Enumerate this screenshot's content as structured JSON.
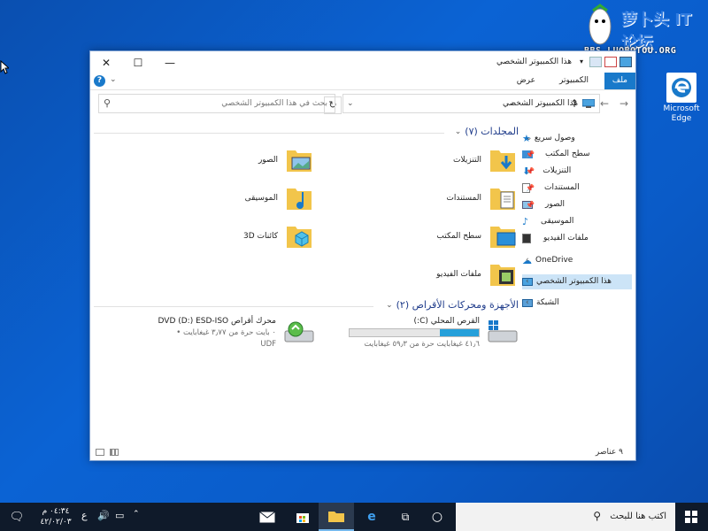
{
  "watermark": {
    "logo": "萝卜头 IT论坛",
    "site": "BBS.LUOBOTOU.ORG"
  },
  "desktop": {
    "edge_label_line1": "Microsoft",
    "edge_label_line2": "Edge"
  },
  "window": {
    "title": "هذا الكمبيوتر الشخصي",
    "tabs": {
      "file": "ملف",
      "computer": "الكمبيوتر",
      "view": "عرض"
    },
    "address": "هذا الكمبيوتر الشخصي",
    "search_placeholder": "بحث في هذا الكمبيوتر الشخصي",
    "folders_header": "المجلدات (٧)",
    "folders": [
      {
        "label": "التنزيلات",
        "icon": "downloads-folder-icon"
      },
      {
        "label": "الصور",
        "icon": "pictures-folder-icon"
      },
      {
        "label": "المستندات",
        "icon": "documents-folder-icon"
      },
      {
        "label": "الموسيقى",
        "icon": "music-folder-icon"
      },
      {
        "label": "سطح المكتب",
        "icon": "desktop-folder-icon"
      },
      {
        "label": "كائنات 3D",
        "icon": "3d-objects-folder-icon"
      },
      {
        "label": "ملفات الفيديو",
        "icon": "videos-folder-icon"
      }
    ],
    "drives_header": "الأجهزة ومحركات الأقراص (٢)",
    "drive_c": {
      "name": "القرص المحلي (C:)",
      "free": "٤١٫٦ غيغابايت حرة من ٥٩٫٣ غيغابايت",
      "used_fraction": 0.3
    },
    "drive_d": {
      "name": "محرك أقراص DVD (D:) ESD-ISO",
      "free": "٠ بايت حرة من ٣٫٧٧ غيغابايت",
      "fs": "UDF"
    },
    "nav": {
      "quick_access": "وصول سريع",
      "desktop": "سطح المكتب",
      "downloads": "التنزيلات",
      "documents": "المستندات",
      "pictures": "الصور",
      "music": "الموسيقى",
      "videos": "ملفات الفيديو",
      "onedrive": "OneDrive",
      "this_pc": "هذا الكمبيوتر الشخصي",
      "network": "الشبكة"
    },
    "status": "٩ عناصر"
  },
  "taskbar": {
    "search_placeholder": "اكتب هنا للبحث",
    "time": "٠٤:٣٤ م",
    "date": "٤٢/٠٢/٠٣",
    "lang": "ع"
  },
  "colors": {
    "accent": "#1979ca",
    "desktop": "#0b63d4",
    "taskbar": "#0f1a2a"
  }
}
